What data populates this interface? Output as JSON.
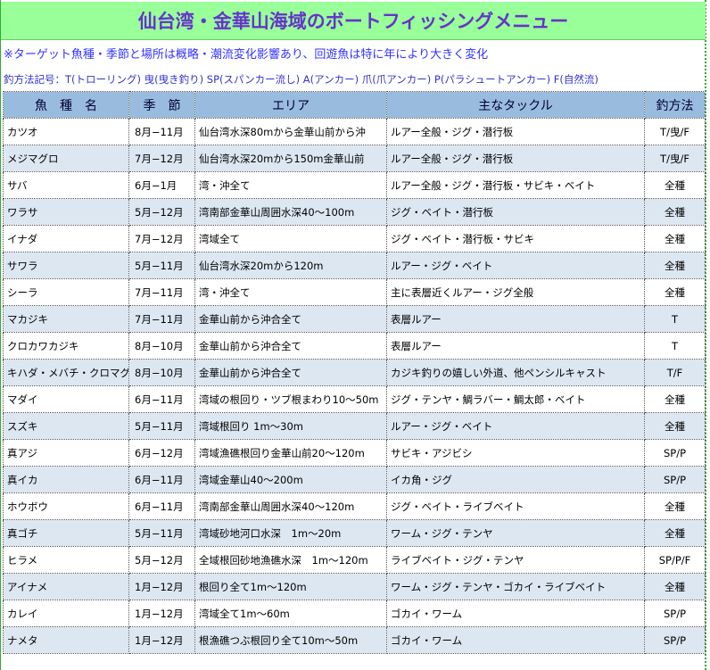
{
  "title": "仙台湾・金華山海域のボートフィッシングメニュー",
  "note_main": "※ターゲット魚種・季節と場所は概略・潮流変化影響あり、回遊魚は特に年により大きく変化",
  "note_methods": "釣方法記号：T(トローリング) 曳(曳き釣り) SP(スパンカー流し) A(アンカー) 爪(爪アンカー) P(パラシュートアンカー) F(自然流)",
  "columns": [
    "魚　種　名",
    "季　節",
    "エリア",
    "主なタックル",
    "釣方法"
  ],
  "rows": [
    {
      "fish": "カツオ",
      "season": "8月−11月",
      "area": "仙台湾水深80mから金華山前から沖",
      "tackle": "ルアー全般・ジグ・潜行板",
      "method": "T/曳/F"
    },
    {
      "fish": "メジマグロ",
      "season": "7月−12月",
      "area": "仙台湾水深20mから150m金華山前",
      "tackle": "ルアー全般・ジグ・潜行板",
      "method": "T/曳/F"
    },
    {
      "fish": "サバ",
      "season": "6月−1月",
      "area": "湾・沖全て",
      "tackle": "ルアー全般・ジグ・潜行板・サビキ・ベイト",
      "method": "全種"
    },
    {
      "fish": "ワラサ",
      "season": "5月−12月",
      "area": "湾南部金華山周囲水深40〜100m",
      "tackle": "ジグ・ベイト・潜行板",
      "method": "全種"
    },
    {
      "fish": "イナダ",
      "season": "7月−12月",
      "area": "湾域全て",
      "tackle": "ジグ・ベイト・潜行板・サビキ",
      "method": "全種"
    },
    {
      "fish": "サワラ",
      "season": "5月−11月",
      "area": "仙台湾水深20mから120m",
      "tackle": "ルアー・ジグ・ベイト",
      "method": "全種"
    },
    {
      "fish": "シーラ",
      "season": "7月−11月",
      "area": "湾・沖全て",
      "tackle": "主に表層近くルアー・ジグ全般",
      "method": "全種"
    },
    {
      "fish": "マカジキ",
      "season": "7月−11月",
      "area": "金華山前から沖合全て",
      "tackle": "表層ルアー",
      "method": "T"
    },
    {
      "fish": "クロカワカジキ",
      "season": "8月−10月",
      "area": "金華山前から沖合全て",
      "tackle": "表層ルアー",
      "method": "T"
    },
    {
      "fish": "キハダ・メバチ・クロマグロ",
      "season": "8月−10月",
      "area": "金華山前から沖合全て",
      "tackle": "カジキ釣りの嬉しい外道、他ペンシルキャスト",
      "method": "T/F"
    },
    {
      "fish": "マダイ",
      "season": "6月−11月",
      "area": "湾域の根回り・ツブ根まわり10〜50m",
      "tackle": "ジグ・テンヤ・鯛ラバー・鯛太郎・ベイト",
      "method": "全種"
    },
    {
      "fish": "スズキ",
      "season": "5月−11月",
      "area": "湾域根回り 1m〜30m",
      "tackle": "ルアー・ジグ・ベイト",
      "method": "全種"
    },
    {
      "fish": "真アジ",
      "season": "6月−12月",
      "area": "湾域漁礁根回り金華山前20〜120m",
      "tackle": "サビキ・アジビシ",
      "method": "SP/P"
    },
    {
      "fish": "真イカ",
      "season": "6月−11月",
      "area": "湾域金華山40〜200m",
      "tackle": "イカ角・ジグ",
      "method": "SP/P"
    },
    {
      "fish": "ホウボウ",
      "season": "6月−11月",
      "area": "湾南部金華山周囲水深40〜120m",
      "tackle": "ジグ・ベイト・ライブベイト",
      "method": "全種"
    },
    {
      "fish": "真ゴチ",
      "season": "5月−11月",
      "area": "湾域砂地河口水深　1m〜20m",
      "tackle": "ワーム・ジグ・テンヤ",
      "method": "全種"
    },
    {
      "fish": "ヒラメ",
      "season": "5月−12月",
      "area": "全域根回砂地漁礁水深　1m〜120m",
      "tackle": "ライブベイト・ジグ・テンヤ",
      "method": "SP/P/F"
    },
    {
      "fish": "アイナメ",
      "season": "1月−12月",
      "area": "根回り全て1m〜120m",
      "tackle": "ワーム・ジグ・テンヤ・ゴカイ・ライブベイト",
      "method": "全種"
    },
    {
      "fish": "カレイ",
      "season": "1月−12月",
      "area": "湾域全て1m〜60m",
      "tackle": "ゴカイ・ワーム",
      "method": "SP/P"
    },
    {
      "fish": "ナメタ",
      "season": "1月−12月",
      "area": "根漁礁つぶ根回り全て10m〜50m",
      "tackle": "ゴカイ・ワーム",
      "method": "SP/P"
    }
  ]
}
